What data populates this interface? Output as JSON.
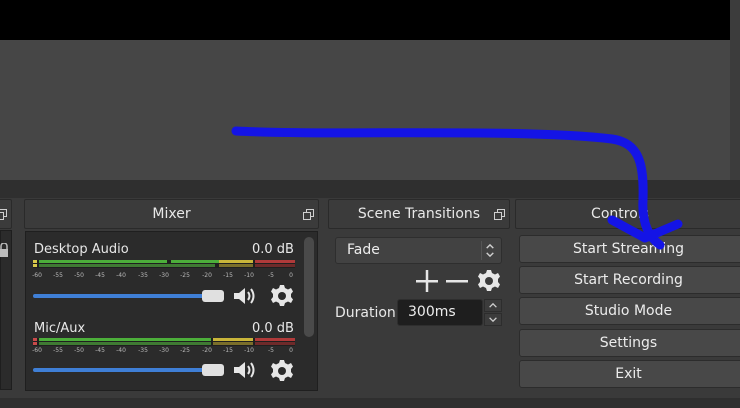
{
  "docks": {
    "mixer_title": "Mixer",
    "transitions_title": "Scene Transitions",
    "controls_title": "Controls"
  },
  "mixer": {
    "channels": [
      {
        "name": "Desktop Audio",
        "db": "0.0 dB",
        "volume": 0.92
      },
      {
        "name": "Mic/Aux",
        "db": "0.0 dB",
        "volume": 0.92
      }
    ],
    "ticks": [
      "-60",
      "-55",
      "-50",
      "-45",
      "-40",
      "-35",
      "-30",
      "-25",
      "-20",
      "-15",
      "-10",
      "-5",
      "0"
    ]
  },
  "transitions": {
    "selected": "Fade",
    "duration_label": "Duration",
    "duration_value": "300ms"
  },
  "controls": {
    "buttons": [
      "Start Streaming",
      "Start Recording",
      "Studio Mode",
      "Settings",
      "Exit"
    ]
  },
  "colors": {
    "annotation": "#1414e6",
    "meter_green": "#4caf3a",
    "meter_yellow": "#c9b53a",
    "meter_red": "#b03a3a",
    "volume_blue": "#3f7fd6"
  }
}
